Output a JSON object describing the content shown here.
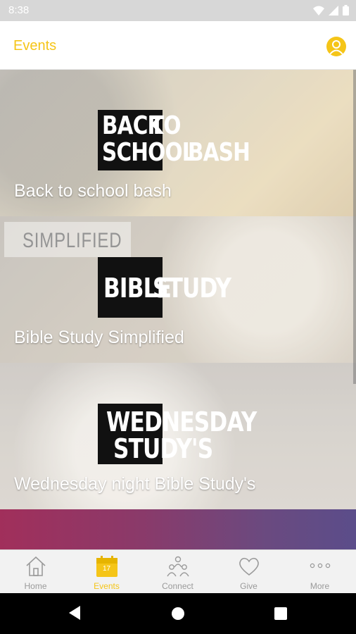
{
  "status_bar": {
    "time": "8:38"
  },
  "app_bar": {
    "title": "Events"
  },
  "events": [
    {
      "logo_line1_boxed": "BACK",
      "logo_line1_rest": " TO",
      "logo_line2_boxed": "SCHOOL",
      "logo_line2_rest": " BASH",
      "title": "Back to school bash"
    },
    {
      "logo_line1_boxed": "BIBLE",
      "logo_line1_rest": " STUDY",
      "bg_text": "SIMPLIFIED",
      "title": "Bible Study Simplified"
    },
    {
      "logo_line1_boxed": "WEDNESDAY",
      "logo_line2_boxed": "STUDY'S",
      "title": "Wednesday night Bible Study's"
    }
  ],
  "bottom_nav": {
    "items": [
      {
        "label": "Home",
        "icon": "home-icon"
      },
      {
        "label": "Events",
        "icon": "calendar-icon",
        "badge": "17",
        "active": true
      },
      {
        "label": "Connect",
        "icon": "people-icon"
      },
      {
        "label": "Give",
        "icon": "heart-icon"
      },
      {
        "label": "More",
        "icon": "more-icon"
      }
    ]
  },
  "colors": {
    "accent": "#f5c518",
    "inactive": "#9a9a9a"
  }
}
